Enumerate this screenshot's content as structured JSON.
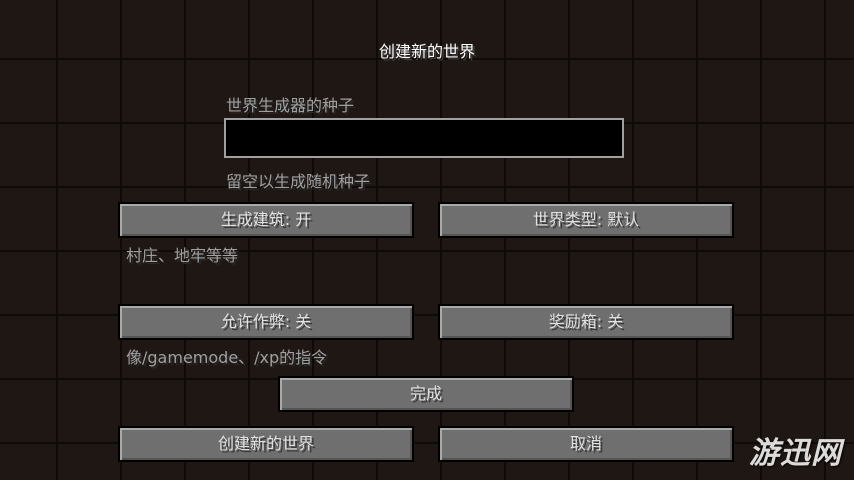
{
  "screen": {
    "title": "创建新的世界",
    "seed_label": "世界生成器的种子",
    "seed_value": "",
    "seed_hint": "留空以生成随机种子",
    "generate_structures_button": "生成建筑: 开",
    "structures_hint": "村庄、地牢等等",
    "world_type_button": "世界类型: 默认",
    "allow_cheats_button": "允许作弊: 关",
    "cheats_hint": "像/gamemode、/xp的指令",
    "bonus_chest_button": "奖励箱: 关",
    "done_button": "完成",
    "create_world_button": "创建新的世界",
    "cancel_button": "取消"
  },
  "watermark": "游迅网"
}
